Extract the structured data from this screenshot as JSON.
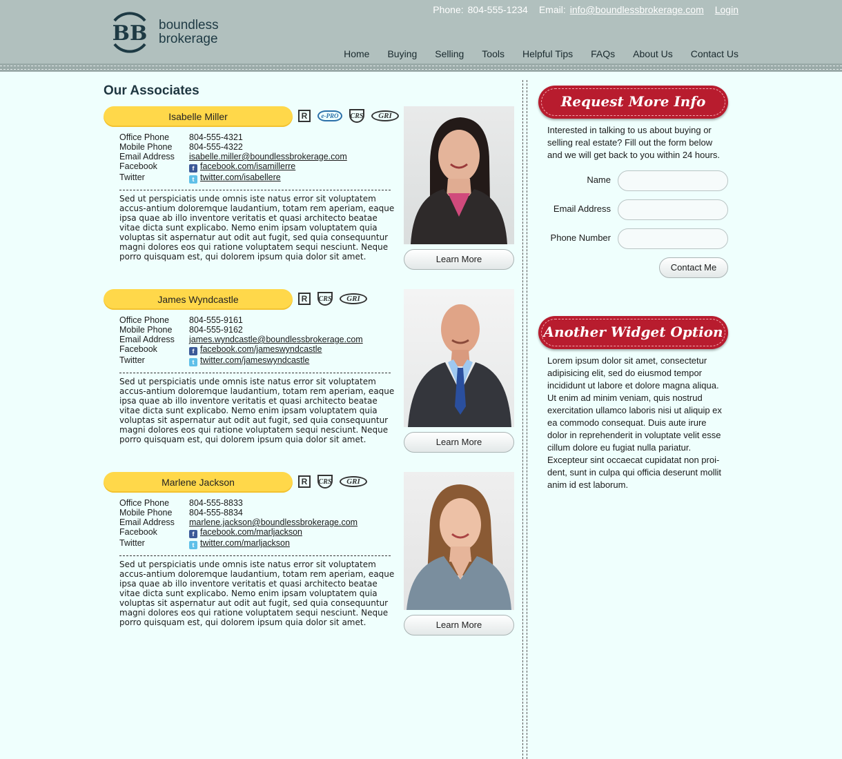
{
  "header": {
    "logo": {
      "mark": "BB",
      "line1": "boundless",
      "line2": "brokerage"
    },
    "contact": {
      "phone_label": "Phone:",
      "phone": "804-555-1234",
      "email_label": "Email:",
      "email": "info@boundlessbrokerage.com",
      "login": "Login"
    },
    "nav": [
      "Home",
      "Buying",
      "Selling",
      "Tools",
      "Helpful Tips",
      "FAQs",
      "About Us",
      "Contact Us"
    ]
  },
  "main": {
    "title": "Our Associates",
    "contact_labels": {
      "office": "Office Phone",
      "mobile": "Mobile Phone",
      "email": "Email Address",
      "facebook": "Facebook",
      "twitter": "Twitter"
    },
    "learn_more": "Learn More",
    "bio": "Sed ut perspiciatis unde omnis iste natus error sit voluptatem accus-antium doloremque laudantium, totam rem aperiam, eaque ipsa quae ab illo inventore veritatis et quasi architecto beatae vitae dicta sunt explicabo. Nemo enim ipsam voluptatem quia voluptas sit aspernatur aut odit aut fugit, sed quia consequuntur magni dolores eos qui ratione voluptatem sequi nesciunt. Neque porro quisquam est, qui dolorem ipsum quia dolor sit amet.",
    "badges": {
      "r": "R",
      "epro": "e-PRO",
      "crs": "CRS",
      "gri": "GRI"
    },
    "associates": [
      {
        "name": "Isabelle Miller",
        "office": "804-555-4321",
        "mobile": "804-555-4322",
        "email": "isabelle.miller@boundlessbrokerage.com",
        "facebook": "facebook.com/isamillerre",
        "twitter": "twitter.com/isabellere",
        "photo": "woman-dark-hair-portrait"
      },
      {
        "name": "James Wyndcastle",
        "office": "804-555-9161",
        "mobile": "804-555-9162",
        "email": "james.wyndcastle@boundlessbrokerage.com",
        "facebook": "facebook.com/jameswyndcastle",
        "twitter": "twitter.com/jameswyndcastle",
        "photo": "man-suit-portrait"
      },
      {
        "name": "Marlene Jackson",
        "office": "804-555-8833",
        "mobile": "804-555-8834",
        "email": "marlene.jackson@boundlessbrokerage.com",
        "facebook": "facebook.com/marljackson",
        "twitter": "twitter.com/marljackson",
        "photo": "woman-auburn-hair-portrait"
      }
    ]
  },
  "sidebar": {
    "request": {
      "title": "Request More Info",
      "intro": "Interested in talking to us about buying or selling real estate? Fill out the form below and we will get back to you within 24 hours.",
      "fields": {
        "name": "Name",
        "email": "Email Address",
        "phone": "Phone Number"
      },
      "submit": "Contact Me"
    },
    "widget2": {
      "title": "Another Widget Option",
      "text": "Lorem ipsum dolor sit amet, consectetur adipisicing elit, sed do eiusmod tempor incididunt ut labore et dolore magna aliqua. Ut enim ad minim veniam, quis nostrud exercitation ullamco laboris nisi ut aliquip ex ea commodo consequat. Duis aute irure dolor in reprehenderit in voluptate velit esse cillum dolore eu fugiat nulla pariatur. Excepteur sint occaecat cupidatat non proi-dent, sunt in culpa qui officia deserunt mollit anim id est laborum."
    }
  },
  "colors": {
    "header_bg": "#b1c0be",
    "page_bg": "#effffd",
    "name_pill": "#ffd84a",
    "widget_red": "#b81c2e",
    "logo_dark": "#1e3a44"
  }
}
